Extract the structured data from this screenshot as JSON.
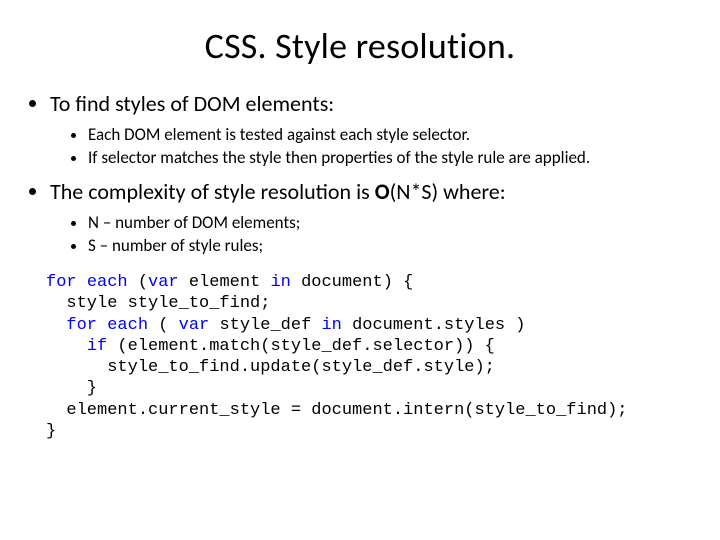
{
  "title": "CSS. Style resolution.",
  "bullets": {
    "b1": "To find styles of DOM elements:",
    "b1_1": "Each DOM element is tested against each style selector.",
    "b1_2": "If selector matches the style then properties of the style rule are applied.",
    "b2_pre": "The complexity of style resolution is ",
    "b2_bold": "O",
    "b2_post": "(N*S) where:",
    "b2_1": "N – number of DOM elements;",
    "b2_2": "S – number of style rules;"
  },
  "code": {
    "kw_for": "for",
    "kw_each": "each",
    "kw_var": "var",
    "kw_in": "in",
    "kw_if": "if",
    "l1_a": " (",
    "l1_b": " element ",
    "l1_c": " document) {",
    "l2": "  style style_to_find;",
    "l3_a": "  ",
    "l3_b": " ( ",
    "l3_c": " style_def ",
    "l3_d": " document.styles )",
    "l4_a": "    ",
    "l4_b": " (element.match(style_def.selector)) {",
    "l5": "      style_to_find.update(style_def.style);",
    "l6": "    }",
    "l7": "  element.current_style = document.intern(style_to_find);",
    "l8": "}"
  }
}
